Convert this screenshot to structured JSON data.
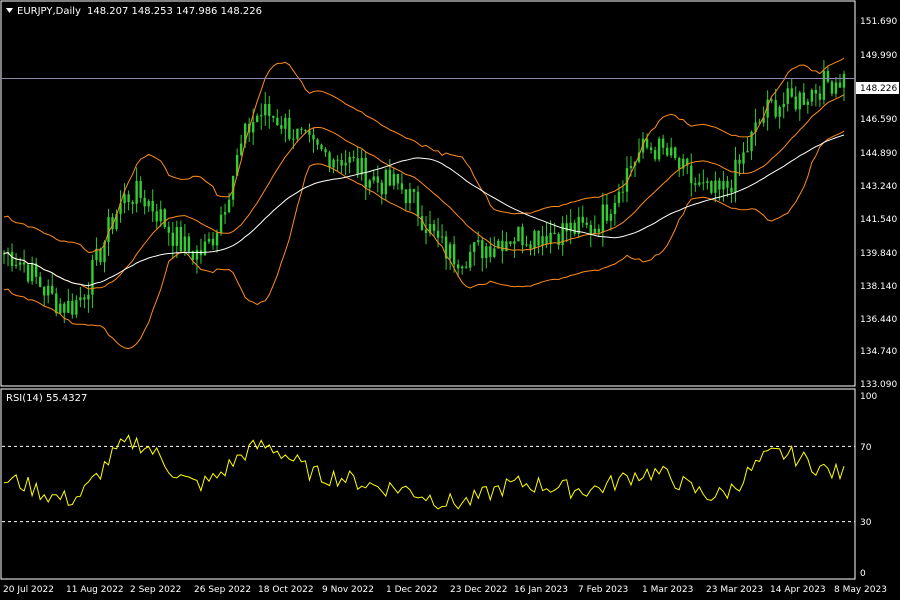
{
  "header": {
    "symbol_timeframe": "EURJPY,Daily",
    "ohlc_values": "148.207 148.253 147.986 148.226"
  },
  "price_panel": {
    "y_ticks": [
      "151.690",
      "149.990",
      "146.590",
      "144.890",
      "143.240",
      "141.540",
      "139.840",
      "138.140",
      "136.440",
      "134.740",
      "133.090"
    ],
    "current_price_label": "148.226"
  },
  "rsi_panel": {
    "label": "RSI(14) 55.4327",
    "y_ticks": [
      "100",
      "70",
      "30",
      "0"
    ],
    "levels": [
      70,
      30
    ]
  },
  "x_ticks": [
    "20 Jul 2022",
    "11 Aug 2022",
    "2 Sep 2022",
    "26 Sep 2022",
    "18 Oct 2022",
    "9 Nov 2022",
    "1 Dec 2022",
    "23 Dec 2022",
    "16 Jan 2023",
    "7 Feb 2023",
    "1 Mar 2023",
    "23 Mar 2023",
    "14 Apr 2023",
    "8 May 2023"
  ],
  "colors": {
    "background": "#000000",
    "candle": "#33cc33",
    "bollinger": "#ff8c1a",
    "moving_average": "#ffffff",
    "rsi_line": "#ffff00",
    "grid_text": "#ffffff",
    "current_price_line": "#8a8aa8"
  },
  "chart_data": {
    "type": "line",
    "title": "EURJPY,Daily",
    "x_dates": [
      "20 Jul 2022",
      "11 Aug 2022",
      "2 Sep 2022",
      "26 Sep 2022",
      "18 Oct 2022",
      "9 Nov 2022",
      "1 Dec 2022",
      "23 Dec 2022",
      "16 Jan 2023",
      "7 Feb 2023",
      "1 Mar 2023",
      "23 Mar 2023",
      "14 Apr 2023",
      "8 May 2023"
    ],
    "ylim": [
      133.09,
      152.0
    ],
    "series": [
      {
        "name": "EURJPY",
        "values": [
          139.6,
          137.0,
          142.5,
          139.6,
          146.5,
          144.5,
          143.0,
          139.5,
          140.5,
          140.8,
          144.8,
          142.5,
          147.0,
          148.226
        ]
      }
    ],
    "rsi": {
      "ylim": [
        0,
        100
      ],
      "values": [
        52,
        42,
        72,
        50,
        70,
        54,
        48,
        40,
        50,
        47,
        56,
        44,
        66,
        55.4327
      ]
    }
  }
}
